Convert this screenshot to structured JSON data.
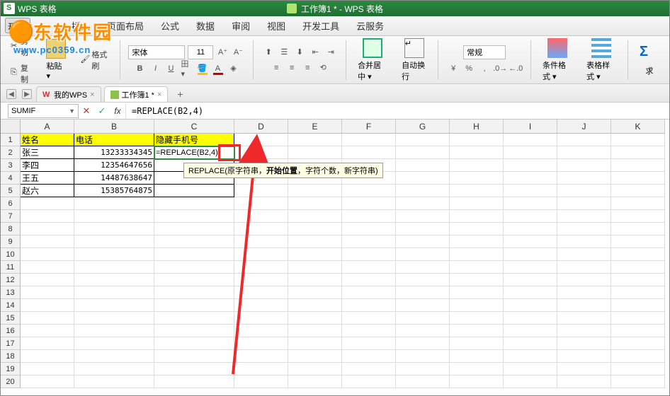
{
  "title_bar": {
    "app_name": "WPS 表格",
    "doc_title": "工作簿1 * - WPS 表格"
  },
  "watermark": {
    "big": "河东软件园",
    "url": "www.pc0359.cn"
  },
  "menu": {
    "file_dd": "开始 ▾",
    "items": [
      "插入",
      "页面布局",
      "公式",
      "数据",
      "审阅",
      "视图",
      "开发工具",
      "云服务"
    ]
  },
  "ribbon": {
    "cut": "剪切",
    "copy": "复制",
    "paste": "粘贴",
    "format_painter": "格式刷",
    "font_name": "宋体",
    "font_size": "11",
    "merge_center": "合并居中",
    "wrap_text": "自动换行",
    "num_format": "常规",
    "cond_format": "条件格式",
    "table_style": "表格样式",
    "sum": "求"
  },
  "tabs": {
    "tab1": "我的WPS",
    "tab1_close": "×",
    "tab2": "工作簿1 *",
    "tab2_close": "×",
    "add": "+"
  },
  "formula_bar": {
    "name_box": "SUMIF",
    "formula": "=REPLACE(B2,4)"
  },
  "col_letters": [
    "A",
    "B",
    "C",
    "D",
    "E",
    "F",
    "G",
    "H",
    "I",
    "J",
    "K"
  ],
  "row_numbers": [
    "1",
    "2",
    "3",
    "4",
    "5",
    "6",
    "7",
    "8",
    "9",
    "10",
    "11",
    "12",
    "13",
    "14",
    "15",
    "16",
    "17",
    "18",
    "19",
    "20"
  ],
  "data": {
    "h_name": "姓名",
    "h_phone": "电话",
    "h_mask": "隐藏手机号",
    "a2": "张三",
    "b2": "13233334345",
    "c2": "=REPLACE(B2,4)",
    "a3": "李四",
    "b3": "12354647656",
    "a4": "王五",
    "b4": "14487638647",
    "a5": "赵六",
    "b5": "15385764875"
  },
  "tooltip": {
    "fn": "REPLACE",
    "open": "(",
    "a1": "原字符串",
    "c": "，",
    "a2": "开始位置",
    "c2": "，",
    "a3": "字符个数",
    "c3": "，",
    "a4": "新字符串",
    "close": ")"
  }
}
